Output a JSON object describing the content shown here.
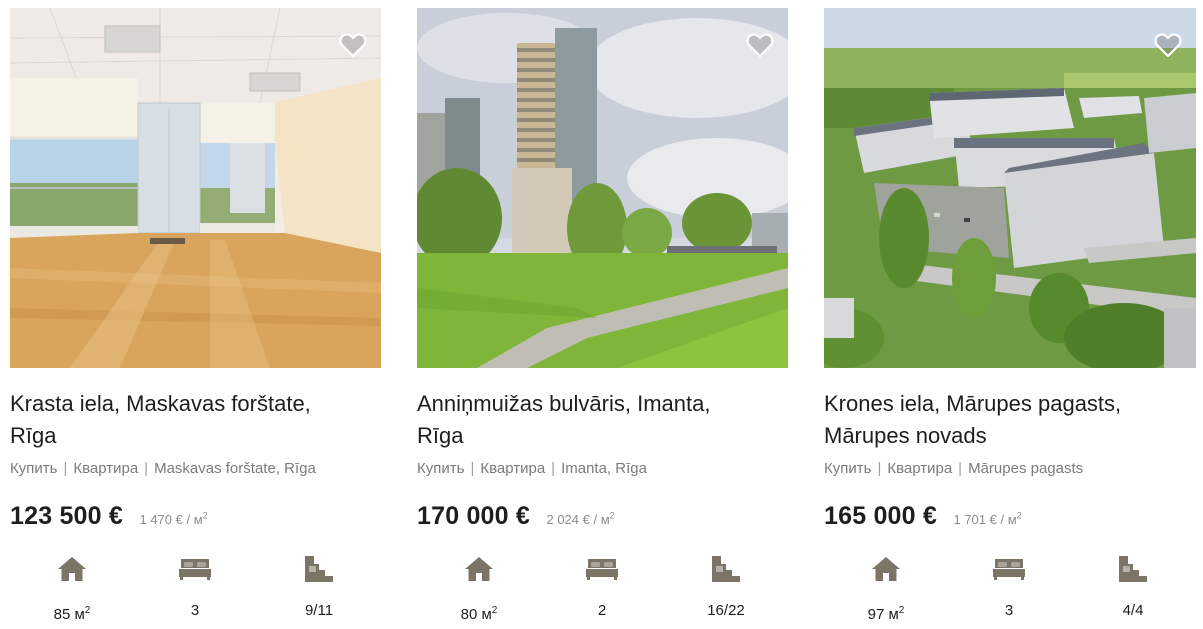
{
  "colors": {
    "icon": "#7d7468",
    "heart": "#6f6f6f",
    "text_main": "#1e1e1e",
    "text_muted": "#7b7b7b"
  },
  "listings": [
    {
      "title_line1": "Krasta iela, Maskavas forštate,",
      "title_line2": "Rīga",
      "crumbs": [
        "Купить",
        "Квартира",
        "Maskavas forštate, Rīga"
      ],
      "price": "123 500 €",
      "price_per_m2": "1 470 € / м",
      "area_value": "85 м",
      "area_sup": "2",
      "rooms": "3",
      "floor": "9/11",
      "photo_icon": "office-interior-photo"
    },
    {
      "title_line1": "Anniņmuižas bulvāris, Imanta,",
      "title_line2": "Rīga",
      "crumbs": [
        "Купить",
        "Квартира",
        "Imanta, Rīga"
      ],
      "price": "170 000 €",
      "price_per_m2": "2 024 € / м",
      "area_value": "80 м",
      "area_sup": "2",
      "rooms": "2",
      "floor": "16/22",
      "photo_icon": "highrise-park-photo"
    },
    {
      "title_line1": "Krones iela, Mārupes pagasts,",
      "title_line2": "Mārupes novads",
      "crumbs": [
        "Купить",
        "Квартира",
        "Mārupes pagasts"
      ],
      "price": "165 000 €",
      "price_per_m2": "1 701 € / м",
      "area_value": "97 м",
      "area_sup": "2",
      "rooms": "3",
      "floor": "4/4",
      "photo_icon": "aerial-complex-photo"
    }
  ],
  "unit_sup": "2"
}
